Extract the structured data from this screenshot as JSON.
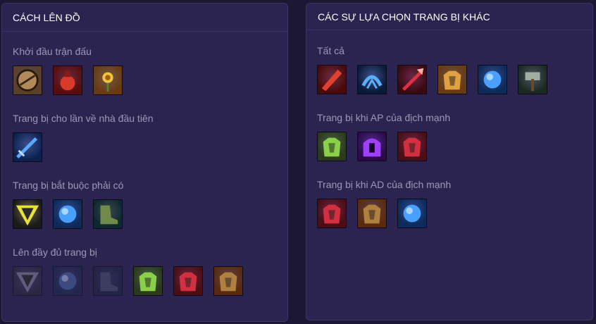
{
  "build": {
    "title": "CÁCH LÊN ĐỒ",
    "sections": [
      {
        "title": "Khởi đầu trận đấu",
        "items": [
          {
            "icon": "round-shield-icon",
            "bg": "#5a4026",
            "fg": "#b08a5a",
            "dim": false
          },
          {
            "icon": "potion-bottle-icon",
            "bg": "#5a0d0d",
            "fg": "#d93a2a",
            "dim": false
          },
          {
            "icon": "golden-flower-icon",
            "bg": "#6b3a10",
            "fg": "#f3c43a",
            "dim": false
          }
        ]
      },
      {
        "title": "Trang bị cho lần về nhà đầu tiên",
        "items": [
          {
            "icon": "blue-sword-icon",
            "bg": "#0d2150",
            "fg": "#5aa8ff",
            "dim": false
          }
        ]
      },
      {
        "title": "Trang bị bắt buộc phải có",
        "items": [
          {
            "icon": "yellow-emblem-icon",
            "bg": "#1a1a1a",
            "fg": "#e8e13a",
            "dim": false
          },
          {
            "icon": "blue-orb-icon",
            "bg": "#0c2a5a",
            "fg": "#4aa0ff",
            "dim": false
          },
          {
            "icon": "green-boots-icon",
            "bg": "#0a2a30",
            "fg": "#6f8a4a",
            "dim": false
          }
        ]
      },
      {
        "title": "Lên đầy đủ trang bị",
        "items": [
          {
            "icon": "yellow-emblem-icon",
            "bg": "#2a2a3a",
            "fg": "#8a8aa0",
            "dim": true
          },
          {
            "icon": "blue-orb-icon",
            "bg": "#1c2a50",
            "fg": "#4a6aa8",
            "dim": true
          },
          {
            "icon": "green-boots-icon",
            "bg": "#1c2440",
            "fg": "#4a5470",
            "dim": true
          },
          {
            "icon": "green-armor-icon",
            "bg": "#2a3a1a",
            "fg": "#8ad04a",
            "dim": false
          },
          {
            "icon": "red-armor-icon",
            "bg": "#4a0e14",
            "fg": "#d23040",
            "dim": false
          },
          {
            "icon": "stone-armor-icon",
            "bg": "#5a2a10",
            "fg": "#b08040",
            "dim": false
          }
        ]
      }
    ]
  },
  "alternatives": {
    "title": "CÁC SỰ LỰA CHỌN TRANG BỊ KHÁC",
    "sections": [
      {
        "title": "Tất cả",
        "items": [
          {
            "icon": "red-blade-icon",
            "bg": "#4a0a0a",
            "fg": "#e04030",
            "dim": false
          },
          {
            "icon": "blue-claw-icon",
            "bg": "#0a1a3a",
            "fg": "#5ab0ff",
            "dim": false
          },
          {
            "icon": "red-spear-icon",
            "bg": "#3a0a10",
            "fg": "#e03040",
            "dim": false
          },
          {
            "icon": "golden-armor-icon",
            "bg": "#6a3a10",
            "fg": "#e0a040",
            "dim": false
          },
          {
            "icon": "blue-orb-icon",
            "bg": "#0c2a5a",
            "fg": "#4aa0ff",
            "dim": false
          },
          {
            "icon": "stone-hammer-icon",
            "bg": "#1a2a20",
            "fg": "#a0b0a0",
            "dim": false
          }
        ]
      },
      {
        "title": "Trang bị khi AP của địch mạnh",
        "items": [
          {
            "icon": "green-armor-icon",
            "bg": "#2a3a1a",
            "fg": "#8ad04a",
            "dim": false
          },
          {
            "icon": "purple-helm-icon",
            "bg": "#2a0a4a",
            "fg": "#a040ff",
            "dim": false
          },
          {
            "icon": "red-armor-icon",
            "bg": "#4a0e14",
            "fg": "#d23040",
            "dim": false
          }
        ]
      },
      {
        "title": "Trang bị khi AD của địch mạnh",
        "items": [
          {
            "icon": "red-armor-icon",
            "bg": "#4a0e14",
            "fg": "#d23040",
            "dim": false
          },
          {
            "icon": "stone-armor-icon",
            "bg": "#5a2a10",
            "fg": "#b08040",
            "dim": false
          },
          {
            "icon": "blue-orb-icon",
            "bg": "#0c2a5a",
            "fg": "#4aa0ff",
            "dim": false
          }
        ]
      }
    ]
  }
}
